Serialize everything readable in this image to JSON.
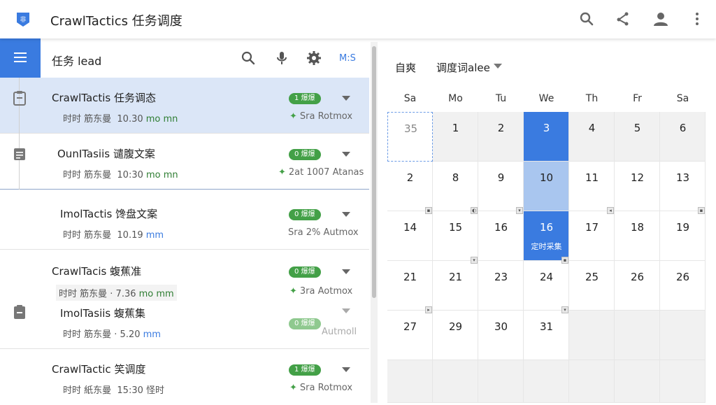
{
  "app": {
    "title": "CrawlTactics 任务调度",
    "logo_glyph": "非",
    "brand_color": "#3a7be0"
  },
  "header_icons": [
    "search-icon",
    "share-icon",
    "account-icon",
    "more-vert-icon"
  ],
  "list": {
    "title": "任务 lead",
    "extra_label": "M:S",
    "tasks": [
      {
        "name": "CrawlTactis 任务调态",
        "meta_a": "时时 筋东曼",
        "meta_b": "10.30 ",
        "meta_c": "mo mn",
        "badge": "1 爆爆",
        "mode": "Sra Rotmox",
        "selected": true
      },
      {
        "name": "OunITasiis 谴腹文案",
        "meta_a": "时时 筋东曼",
        "meta_b": "10:30 ",
        "meta_c": "mo mn",
        "badge": "0 爆爆",
        "mode": "2at 1007 Atanas",
        "selected": false
      },
      {
        "name": "ImolTactis 馋盘文案",
        "meta_a": "时时 筋东曼",
        "meta_b": "10.19 ",
        "meta_c": "mm",
        "badge": "0 爆爆",
        "mode": "Sra 2% Autmox",
        "selected": false
      },
      {
        "name": "CrawlTacis 蝮蕉准",
        "meta_a": "时时 筋东曼 ·",
        "meta_b": "7.36 ",
        "meta_c": "mo mm",
        "badge": "0 爆爆",
        "mode": "3ra Aotmox",
        "selected": false
      },
      {
        "name": "ImolTasiis 蝮蕉集",
        "meta_a": "时时 筋东曼 ·",
        "meta_b": "5.20 ",
        "meta_c": "mm",
        "badge": "0 爆爆",
        "mode": "Autmoll",
        "selected": false
      },
      {
        "name": "CrawlTactic 笑调度",
        "meta_a": "时时 紙东曼",
        "meta_b": "15:30 ",
        "meta_c": "怪时",
        "badge": "1 爆爆",
        "mode": "Sra Rotmox",
        "selected": false
      }
    ]
  },
  "calendar": {
    "tab": "自爽",
    "view_label": "调度词alee",
    "weekdays": [
      "Sa",
      "Mo",
      "Tu",
      "We",
      "Th",
      "Fr",
      "Sa"
    ],
    "rows": [
      [
        "35",
        "1",
        "2",
        "3",
        "4",
        "5",
        "6"
      ],
      [
        "2",
        "8",
        "9",
        "10",
        "11",
        "12",
        "13"
      ],
      [
        "14",
        "15",
        "16",
        "16",
        "17",
        "18",
        "19"
      ],
      [
        "21",
        "21",
        "23",
        "24",
        "25",
        "26",
        "26"
      ],
      [
        "27",
        "29",
        "30",
        "31",
        "",
        "",
        ""
      ]
    ],
    "event_label": "定时采集",
    "highlight_color": "#3a7be0",
    "soft_color": "#a9c6ef"
  }
}
